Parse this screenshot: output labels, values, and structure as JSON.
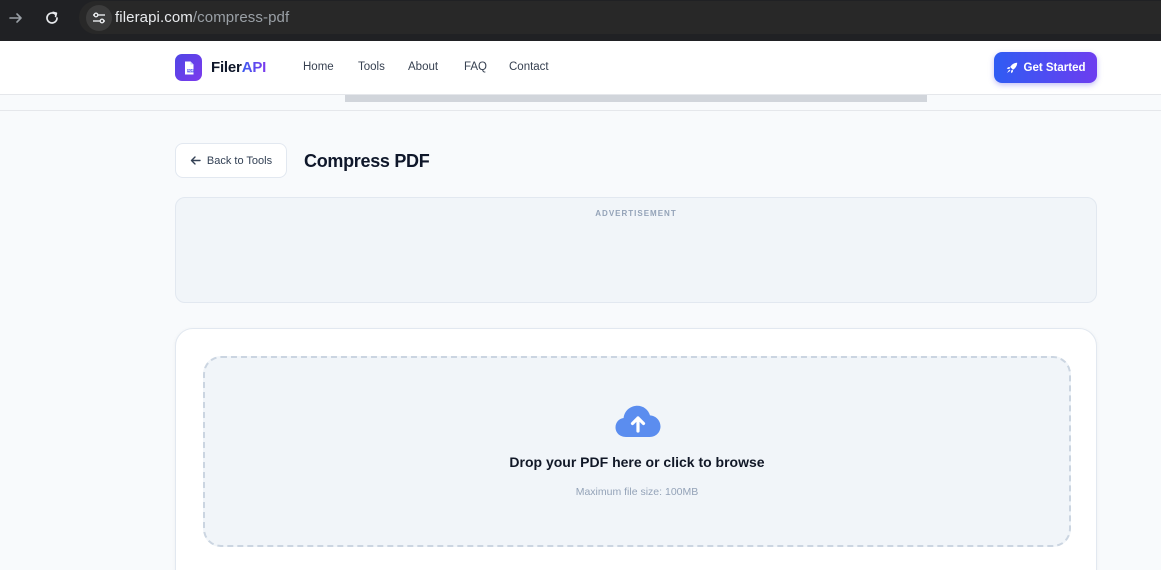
{
  "browser": {
    "url_host": "filerapi.com",
    "url_path": "/compress-pdf",
    "icons": {
      "forward": "arrow-right-icon",
      "reload": "reload-icon",
      "site_info": "tune-icon"
    }
  },
  "header": {
    "brand_part1": "Filer",
    "brand_part2": "API",
    "logo_icon": "pdf-file-icon",
    "nav": [
      "Home",
      "Tools",
      "About",
      "FAQ",
      "Contact"
    ],
    "cta_label": "Get Started",
    "cta_icon": "rocket-icon"
  },
  "page": {
    "back_label": "Back to Tools",
    "back_icon": "arrow-left-icon",
    "title": "Compress PDF"
  },
  "ad": {
    "label": "ADVERTISEMENT"
  },
  "dropzone": {
    "icon": "cloud-upload-icon",
    "title": "Drop your PDF here or click to browse",
    "subtitle": "Maximum file size: 100MB"
  },
  "colors": {
    "accent": "#4f46e5",
    "accent_gradient_start": "#2f5cf3",
    "accent_gradient_end": "#6d3df0",
    "cloud": "#5b8def",
    "dropzone_border": "#cbd5e1"
  }
}
